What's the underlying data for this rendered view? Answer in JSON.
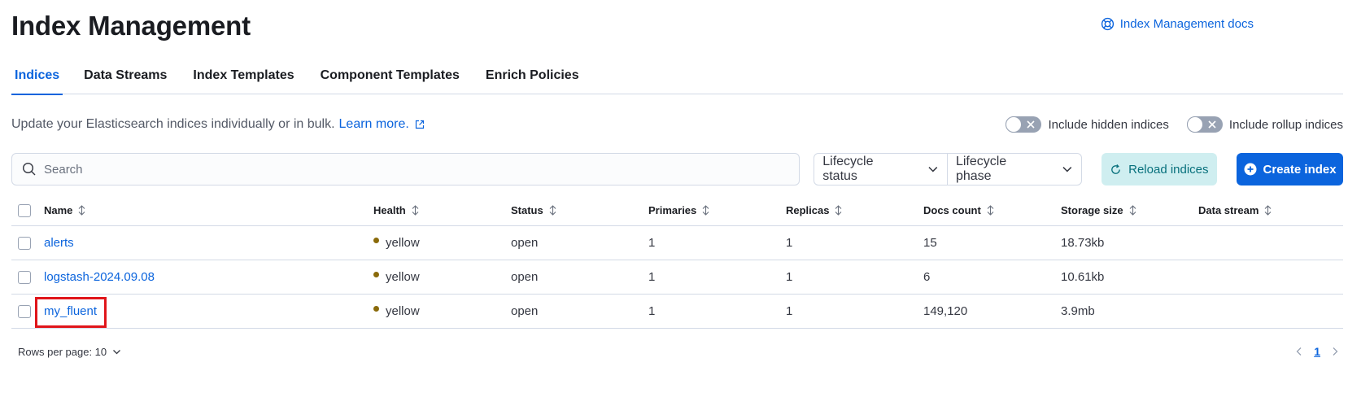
{
  "header": {
    "title": "Index Management",
    "docs_link": "Index Management docs"
  },
  "tabs": [
    {
      "label": "Indices",
      "active": true
    },
    {
      "label": "Data Streams",
      "active": false
    },
    {
      "label": "Index Templates",
      "active": false
    },
    {
      "label": "Component Templates",
      "active": false
    },
    {
      "label": "Enrich Policies",
      "active": false
    }
  ],
  "description": {
    "text": "Update your Elasticsearch indices individually or in bulk.",
    "learn_more": "Learn more."
  },
  "toggles": {
    "hidden": {
      "label": "Include hidden indices",
      "on": false
    },
    "rollup": {
      "label": "Include rollup indices",
      "on": false
    }
  },
  "search": {
    "placeholder": "Search",
    "value": ""
  },
  "filters": {
    "lifecycle_status": "Lifecycle status",
    "lifecycle_phase": "Lifecycle phase"
  },
  "buttons": {
    "reload": "Reload indices",
    "create": "Create index"
  },
  "table": {
    "columns": [
      "Name",
      "Health",
      "Status",
      "Primaries",
      "Replicas",
      "Docs count",
      "Storage size",
      "Data stream"
    ],
    "rows": [
      {
        "name": "alerts",
        "health": "yellow",
        "status": "open",
        "primaries": "1",
        "replicas": "1",
        "docs_count": "15",
        "storage_size": "18.73kb",
        "data_stream": ""
      },
      {
        "name": "logstash-2024.09.08",
        "health": "yellow",
        "status": "open",
        "primaries": "1",
        "replicas": "1",
        "docs_count": "6",
        "storage_size": "10.61kb",
        "data_stream": ""
      },
      {
        "name": "my_fluent",
        "health": "yellow",
        "status": "open",
        "primaries": "1",
        "replicas": "1",
        "docs_count": "149,120",
        "storage_size": "3.9mb",
        "data_stream": ""
      }
    ]
  },
  "footer": {
    "rows_per_page": "Rows per page: 10",
    "current_page": "1"
  },
  "colors": {
    "primary": "#0b64dd",
    "health_yellow": "#8a6a0a",
    "reload_bg": "#cfeef0",
    "highlight": "#e0151a"
  }
}
